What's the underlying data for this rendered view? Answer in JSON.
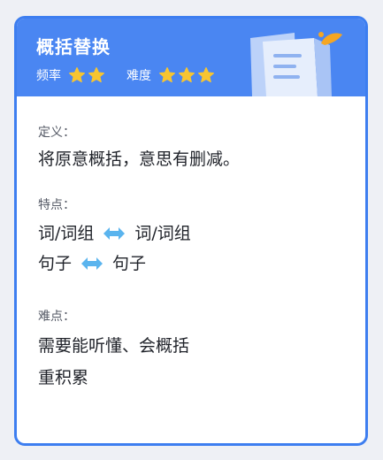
{
  "header": {
    "title": "概括替换",
    "frequency_label": "频率",
    "frequency_stars": 2,
    "difficulty_label": "难度",
    "difficulty_stars": 3,
    "colors": {
      "banner": "#4a86f2",
      "star": "#f7c531",
      "border": "#3d7ef0",
      "arrow": "#5ab4ee"
    }
  },
  "definition": {
    "label": "定义：",
    "text": "将原意概括，意思有删减。"
  },
  "features": {
    "label": "特点：",
    "rows": [
      {
        "left": "词/词组",
        "right": "词/词组",
        "icon": "double-arrow-icon"
      },
      {
        "left": "句子",
        "right": "句子",
        "icon": "double-arrow-icon"
      }
    ]
  },
  "difficulty": {
    "label": "难点：",
    "lines": [
      "需要能听懂、会概括",
      "重积累"
    ]
  }
}
